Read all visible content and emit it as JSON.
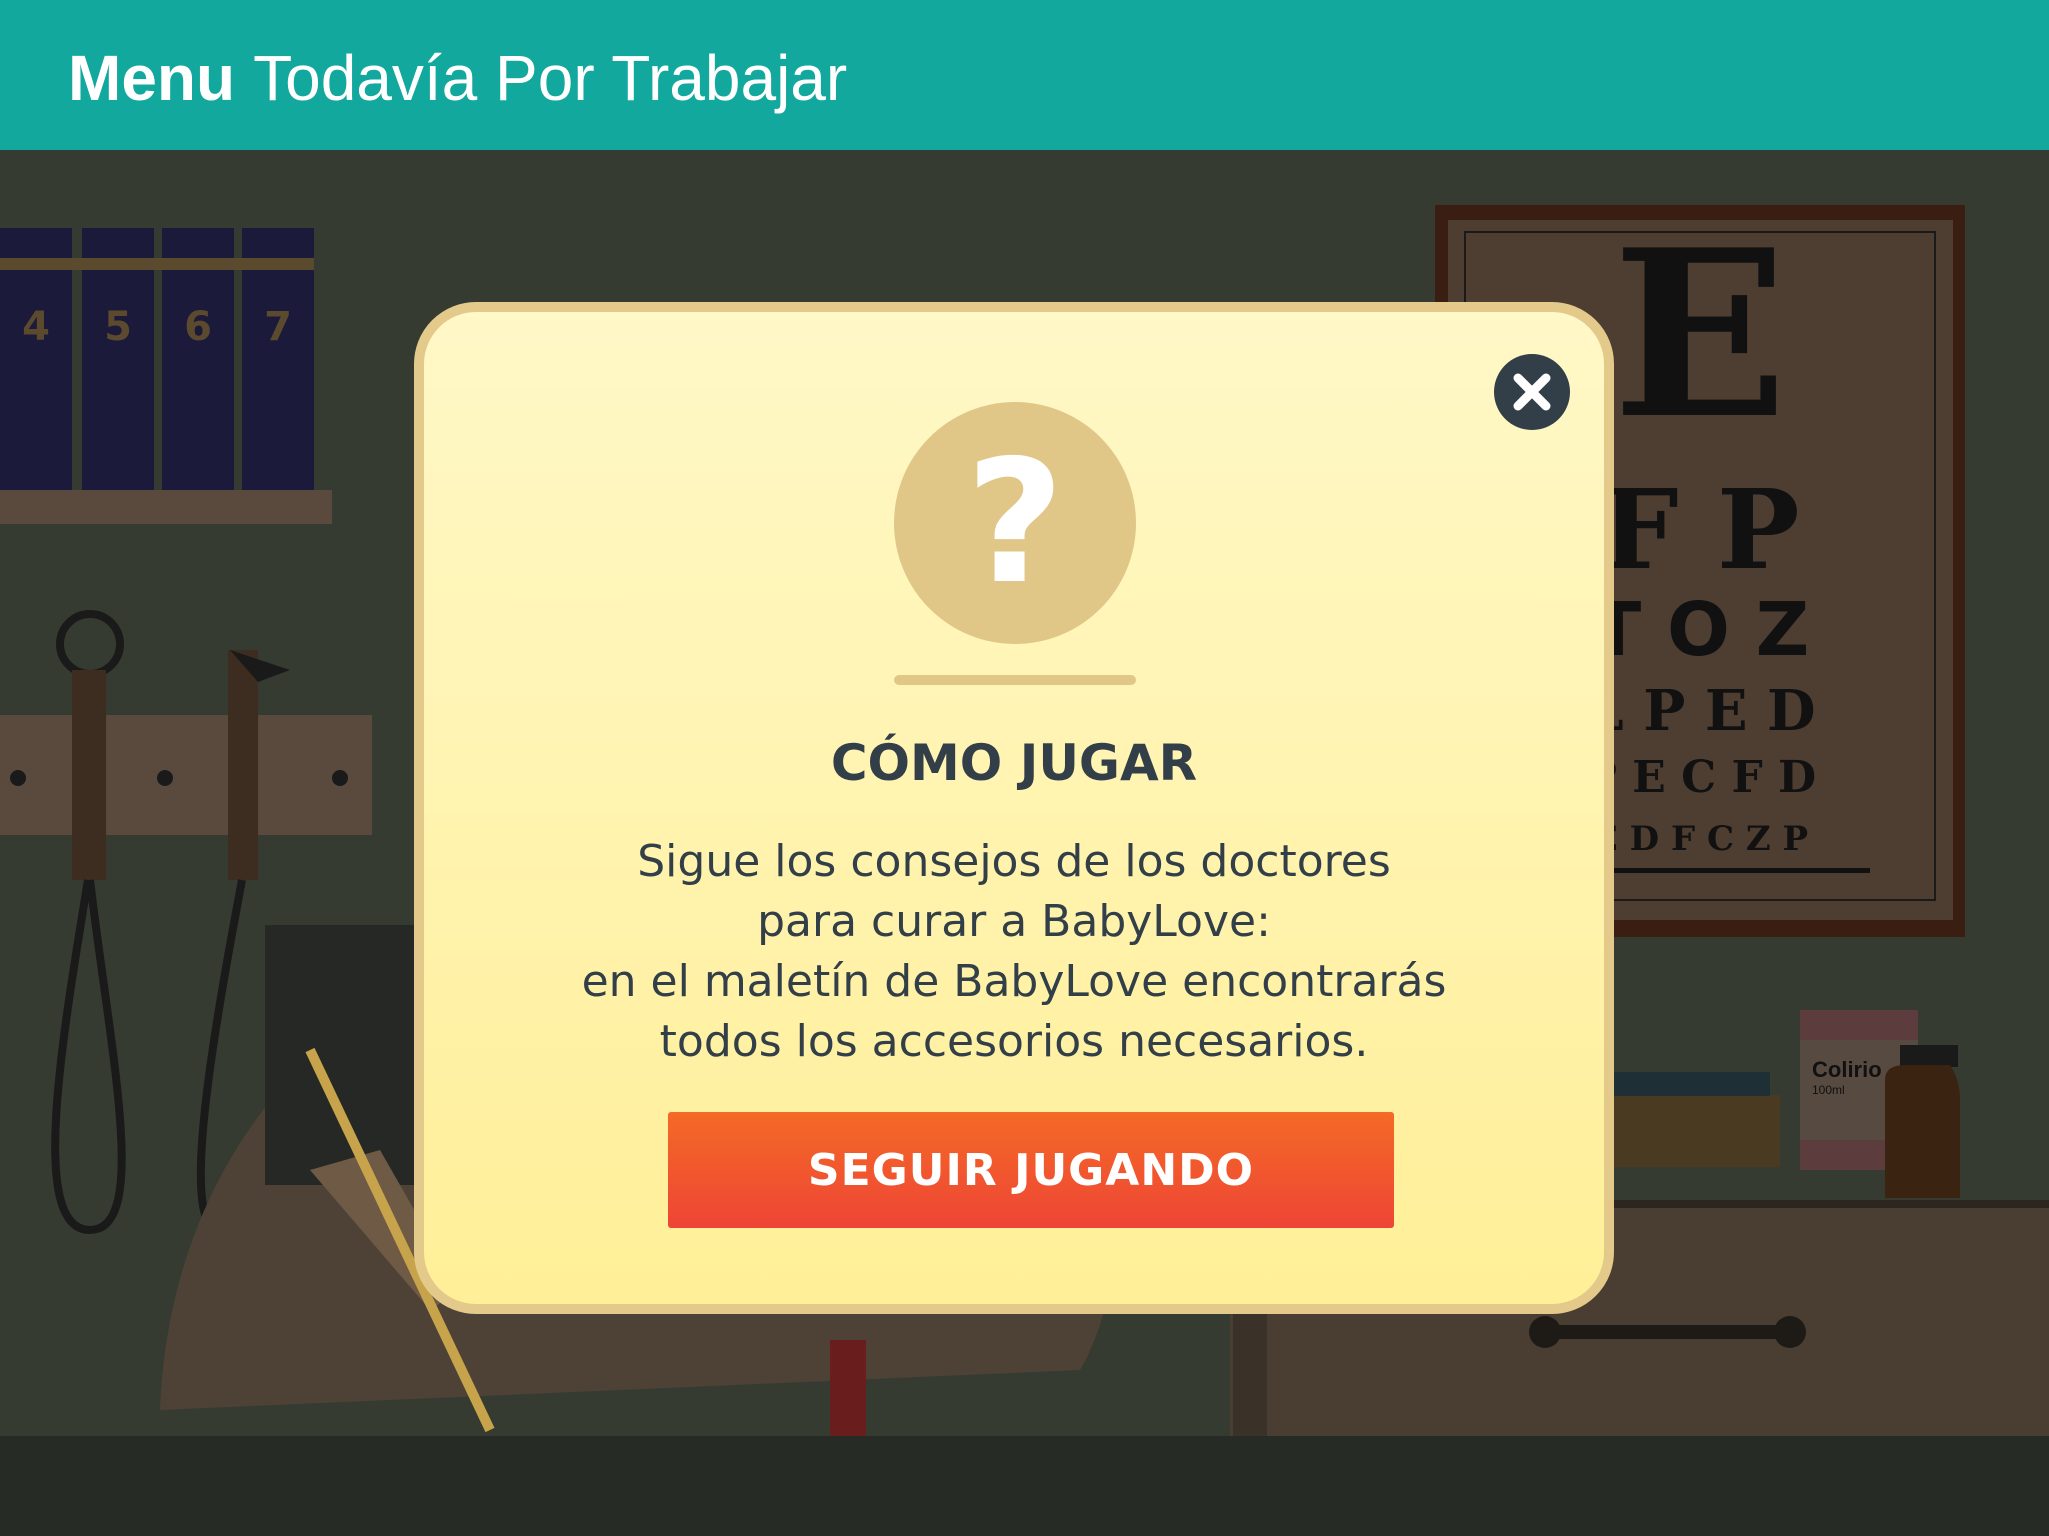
{
  "header": {
    "menu_label": "Menu",
    "subtitle": "Todavía Por Trabajar"
  },
  "background": {
    "book_numbers": [
      "4",
      "5",
      "6",
      "7"
    ],
    "eye_chart_rows": [
      "E",
      "F P",
      "T O Z",
      "L P E D",
      "P E C F D",
      "E D F C Z P"
    ],
    "bottle_label": "Colirio",
    "bottle_volume": "100ml"
  },
  "modal": {
    "title": "CÓMO JUGAR",
    "body_lines": [
      "Sigue los consejos de los doctores",
      "para curar a BabyLove:",
      "en el maletín de BabyLove encontrarás",
      "todos los accesorios necesarios."
    ],
    "play_button_label": "SEGUIR JUGANDO",
    "question_glyph": "?"
  },
  "colors": {
    "header": "#13a89e",
    "modal_bg": "#fff3b0",
    "modal_border": "#e3c98a",
    "button": "#f0553a",
    "text_dark": "#333f48",
    "close_bg": "#333f48"
  },
  "icons": [
    "close-icon",
    "question-icon"
  ]
}
